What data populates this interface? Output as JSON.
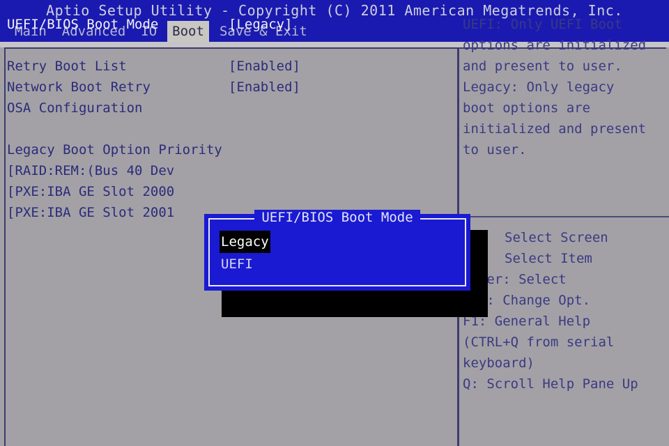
{
  "header": {
    "title": "Aptio Setup Utility - Copyright (C) 2011 American Megatrends, Inc."
  },
  "menu": {
    "tabs": [
      {
        "label": "Main",
        "active": false
      },
      {
        "label": "Advanced",
        "active": false
      },
      {
        "label": "IO",
        "active": false
      },
      {
        "label": "Boot",
        "active": true
      },
      {
        "label": "Save & Exit",
        "active": false
      }
    ]
  },
  "settings": {
    "rows": [
      {
        "label": "UEFI/BIOS Boot Mode",
        "value": "[Legacy]",
        "selected": true
      },
      {
        "label": "Retry Boot List",
        "value": "[Enabled]",
        "selected": false
      },
      {
        "label": "Network Boot Retry",
        "value": "[Enabled]",
        "selected": false
      },
      {
        "label": "OSA Configuration",
        "value": "",
        "selected": false
      }
    ],
    "section_title": "Legacy Boot Option Priority",
    "boot_entries": [
      "[RAID:REM:(Bus 40 Dev",
      "[PXE:IBA GE Slot 2000",
      "[PXE:IBA GE Slot 2001"
    ]
  },
  "help": {
    "lines": [
      "UEFI: Only UEFI Boot",
      "options are initialized",
      "and present to user.",
      "Legacy: Only legacy",
      "boot options are",
      "initialized and present",
      "to user."
    ]
  },
  "nav_help": {
    "lines": [
      {
        "text": "Select Screen",
        "indent": true
      },
      {
        "text": "Select Item",
        "indent": true
      },
      {
        "text": "Enter: Select",
        "indent": false
      },
      {
        "text": "+/-: Change Opt.",
        "indent": false
      },
      {
        "text": "F1: General Help",
        "indent": false
      },
      {
        "text": "(CTRL+Q from serial",
        "indent": false
      },
      {
        "text": "keyboard)",
        "indent": false
      },
      {
        "text": "Q: Scroll Help Pane Up",
        "indent": false
      }
    ]
  },
  "dialog": {
    "title": "UEFI/BIOS Boot Mode",
    "options": [
      {
        "label": "Legacy",
        "highlighted": true
      },
      {
        "label": "UEFI",
        "highlighted": false
      }
    ]
  },
  "colors": {
    "background": "#a3a1a6",
    "titlebar": "#1a1ab0",
    "dialog_blue": "#1a1ad2",
    "text_blue": "#2b2b7a",
    "text_white": "#f2f2f2",
    "highlight_black": "#000000",
    "tab_active_bg": "#c9c7c2"
  }
}
